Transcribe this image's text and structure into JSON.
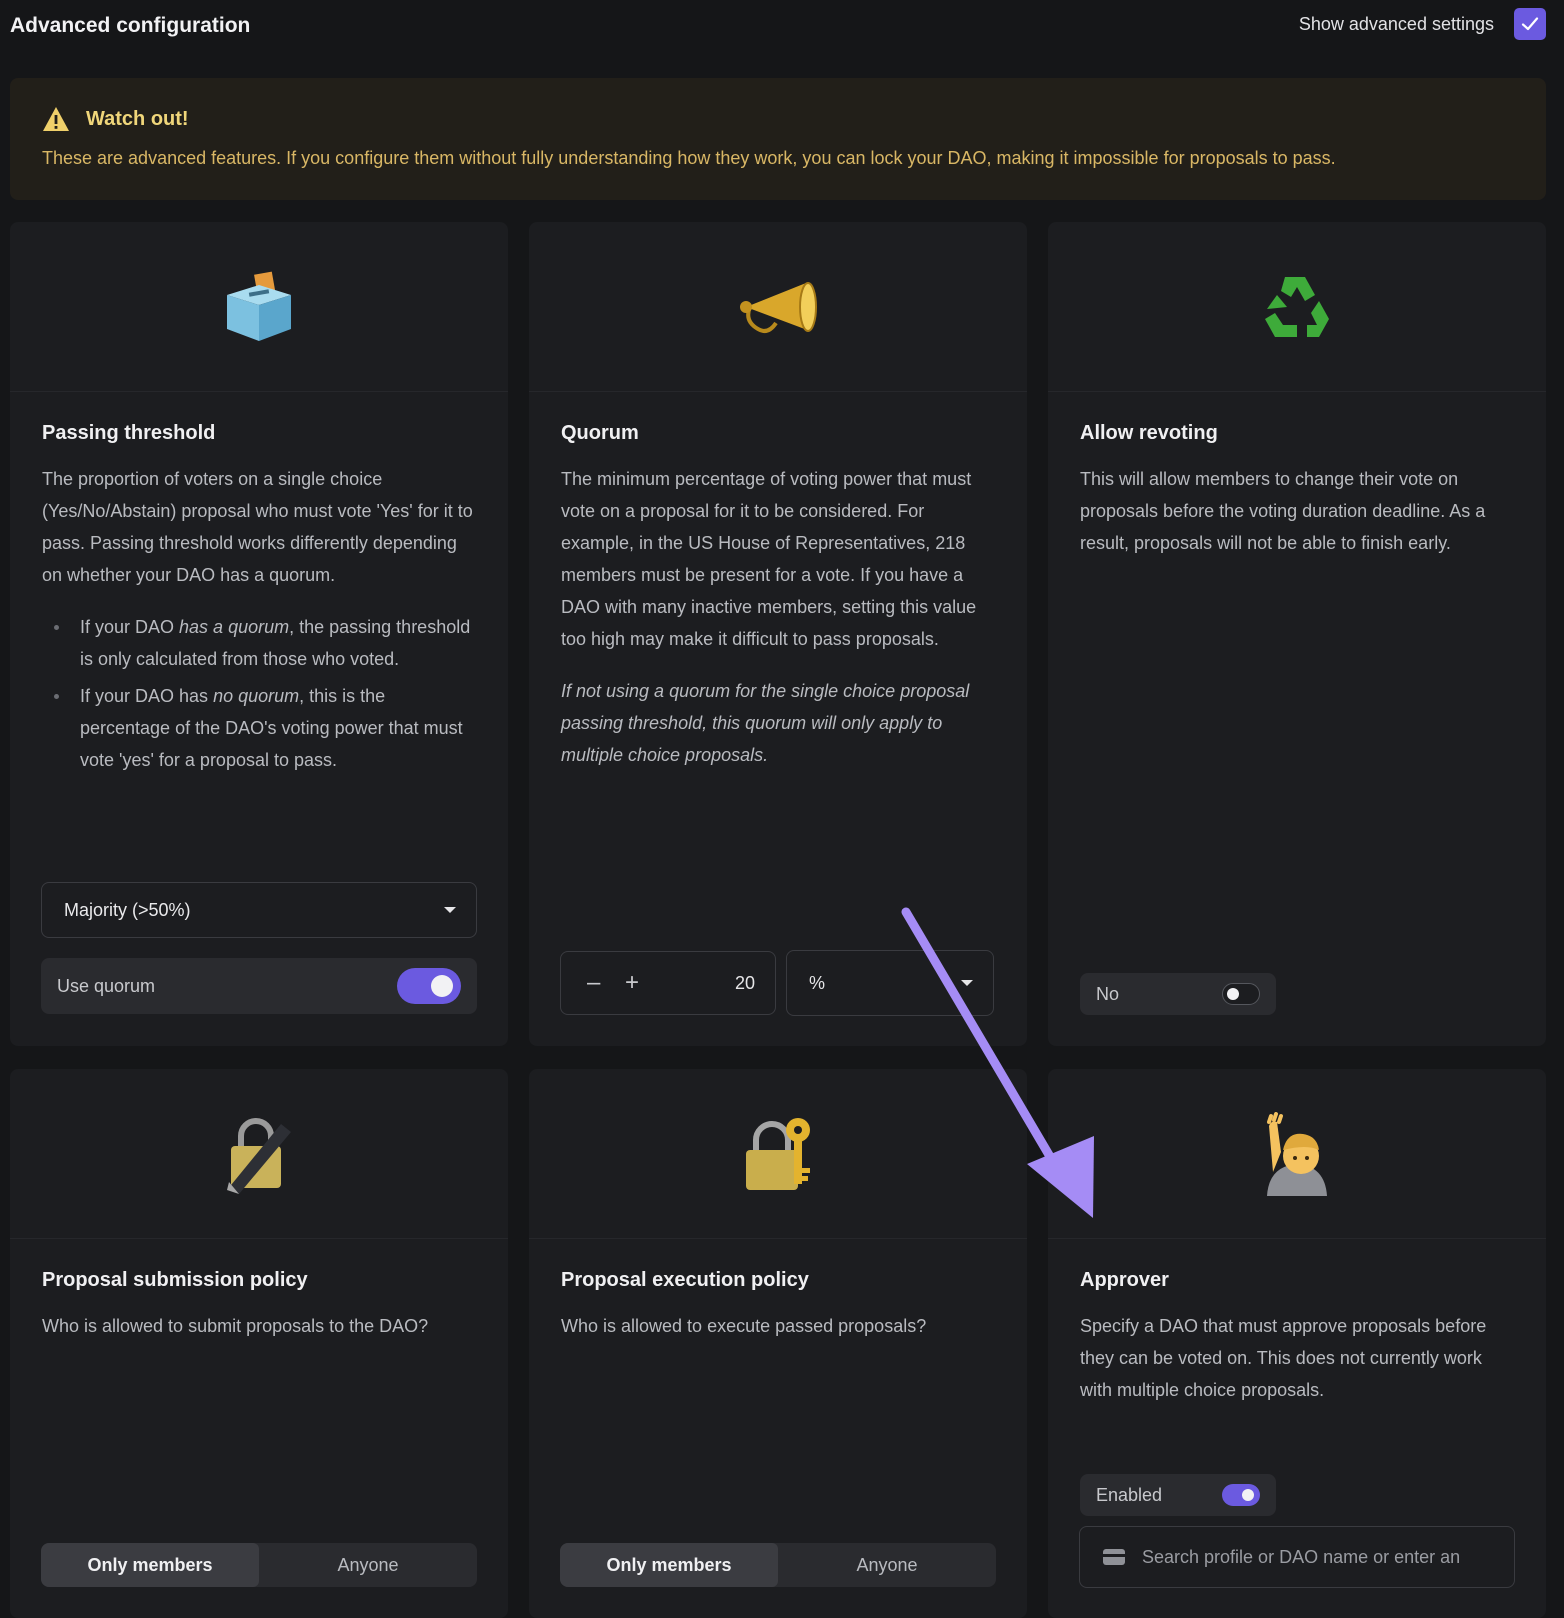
{
  "header": {
    "title": "Advanced configuration",
    "toggle_label": "Show advanced settings",
    "toggle_checked": true
  },
  "warning": {
    "title": "Watch out!",
    "text": "These are advanced features. If you configure them without fully understanding how they work, you can lock your DAO, making it impossible for proposals to pass."
  },
  "cards": {
    "threshold": {
      "emoji": "🗳️",
      "title": "Passing threshold",
      "description": "The proportion of voters on a single choice (Yes/No/Abstain) proposal who must vote 'Yes' for it to pass. Passing threshold works differently depending on whether your DAO has a quorum.",
      "bullet1_pre": "If your DAO ",
      "bullet1_em": "has a quorum",
      "bullet1_post": ", the passing threshold is only calculated from those who voted.",
      "bullet2_pre": "If your DAO has ",
      "bullet2_em": "no quorum",
      "bullet2_post": ", this is the percentage of the DAO's voting power that must vote 'yes' for a proposal to pass.",
      "select_value": "Majority (>50%)",
      "quorum_label": "Use quorum",
      "quorum_enabled": true
    },
    "quorum": {
      "emoji": "📯",
      "title": "Quorum",
      "description": "The minimum percentage of voting power that must vote on a proposal for it to be considered. For example, in the US House of Representatives, 218 members must be present for a vote. If you have a DAO with many inactive members, setting this value too high may make it difficult to pass proposals.",
      "note": "If not using a quorum for the single choice proposal passing threshold, this quorum will only apply to multiple choice proposals.",
      "minus": "–",
      "plus": "+",
      "value": "20",
      "unit": "%"
    },
    "revoting": {
      "emoji": "♻️",
      "title": "Allow revoting",
      "description": "This will allow members to change their vote on proposals before the voting duration deadline. As a result, proposals will not be able to finish early.",
      "switch_label": "No",
      "enabled": false
    },
    "submission": {
      "emoji": "🔏",
      "title": "Proposal submission policy",
      "description": "Who is allowed to submit proposals to the DAO?",
      "options": [
        "Only members",
        "Anyone"
      ],
      "selected": "Only members"
    },
    "execution": {
      "emoji": "🔐",
      "title": "Proposal execution policy",
      "description": "Who is allowed to execute passed proposals?",
      "options": [
        "Only members",
        "Anyone"
      ],
      "selected": "Only members"
    },
    "approver": {
      "emoji": "🙋",
      "title": "Approver",
      "description": "Specify a DAO that must approve proposals before they can be voted on. This does not currently work with multiple choice proposals.",
      "switch_label": "Enabled",
      "enabled": true,
      "search_placeholder": "Search profile or DAO name or enter an"
    }
  },
  "colors": {
    "accent": "#6b5ae0",
    "annotation_arrow": "#a58cf5",
    "warning_text": "#d9b765"
  }
}
